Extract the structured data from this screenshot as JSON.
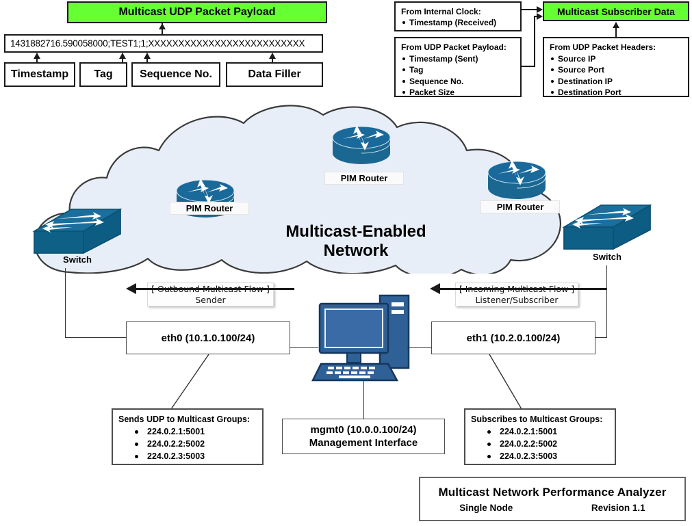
{
  "packet_payload": {
    "header": "Multicast UDP Packet Payload",
    "sample_string": "1431882716.590058000;TEST1;1;XXXXXXXXXXXXXXXXXXXXXXXXXX",
    "fields": [
      {
        "label": "Timestamp"
      },
      {
        "label": "Tag"
      },
      {
        "label": "Sequence No."
      },
      {
        "label": "Data Filler"
      }
    ]
  },
  "subscriber_data": {
    "header": "Multicast Subscriber Data",
    "sources": [
      {
        "title": "From Internal Clock:",
        "items": [
          "Timestamp (Received)"
        ]
      },
      {
        "title": "From UDP Packet Payload:",
        "items": [
          "Timestamp (Sent)",
          "Tag",
          "Sequence No.",
          "Packet Size"
        ]
      },
      {
        "title": "From UDP Packet Headers:",
        "items": [
          "Source IP",
          "Source Port",
          "Destination IP",
          "Destination Port"
        ]
      }
    ]
  },
  "network": {
    "cloud_label_line1": "Multicast-Enabled",
    "cloud_label_line2": "Network",
    "routers": [
      {
        "label": "PIM Router"
      },
      {
        "label": "PIM Router"
      },
      {
        "label": "PIM Router"
      }
    ],
    "switches": [
      {
        "label": "Switch"
      },
      {
        "label": "Switch"
      }
    ]
  },
  "flows": {
    "outbound": {
      "line1": "[ Outbound Multicast Flow ]",
      "line2": "Sender"
    },
    "incoming": {
      "line1": "[ Incoming Multicast Flow ]",
      "line2": "Listener/Subscriber"
    }
  },
  "interfaces": {
    "eth0": "eth0 (10.1.0.100/24)",
    "eth1": "eth1 (10.2.0.100/24)",
    "mgmt0_line1": "mgmt0 (10.0.0.100/24)",
    "mgmt0_line2": "Management Interface"
  },
  "groups": {
    "sender": {
      "title": "Sends UDP to Multicast Groups:",
      "items": [
        "224.0.2.1:5001",
        "224.0.2.2:5002",
        "224.0.2.3:5003"
      ]
    },
    "subscriber": {
      "title": "Subscribes to Multicast Groups:",
      "items": [
        "224.0.2.1:5001",
        "224.0.2.2:5002",
        "224.0.2.3:5003"
      ]
    }
  },
  "title_block": {
    "title": "Multicast Network Performance Analyzer",
    "node": "Single Node",
    "revision": "Revision 1.1"
  },
  "colors": {
    "highlight_green": "#66ff33",
    "device_blue": "#17699b",
    "cloud_fill": "#e8eef7",
    "outline": "#1a1a1a"
  }
}
